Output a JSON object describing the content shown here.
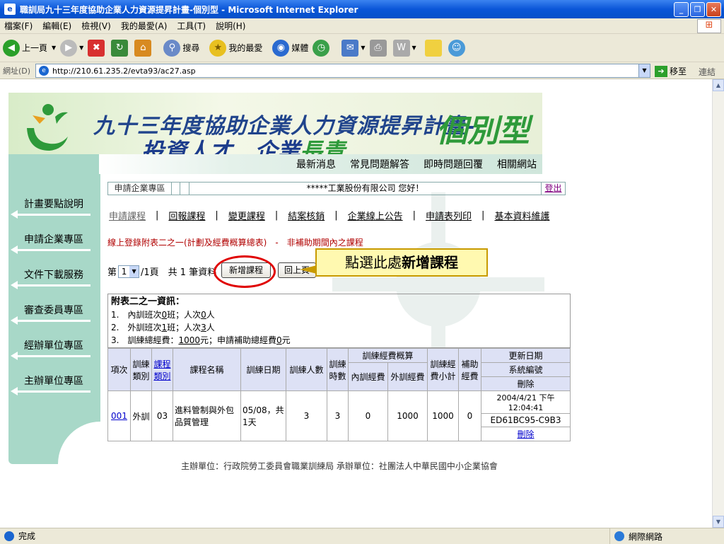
{
  "window": {
    "title": "職訓局九十三年度協助企業人力資源提昇計畫-個別型 - Microsoft Internet Explorer"
  },
  "menu": [
    "檔案(F)",
    "編輯(E)",
    "檢視(V)",
    "我的最愛(A)",
    "工具(T)",
    "說明(H)"
  ],
  "toolbar": {
    "back": "上一頁",
    "search": "搜尋",
    "favorites": "我的最愛",
    "media": "媒體"
  },
  "address": {
    "label": "網址(D)",
    "url": "http://210.61.235.2/evta93/ac27.asp",
    "go": "移至",
    "links": "連結"
  },
  "banner": {
    "line1": "九十三年度協助企業人力資源提昇計畫-",
    "line1b": "個別型",
    "line2a": "投資人才．企業",
    "line2b": "長青"
  },
  "topnav": [
    "最新消息",
    "常見問題解答",
    "即時問題回覆",
    "相關網站"
  ],
  "sidebar": [
    "計畫要點說明",
    "申請企業專區",
    "文件下載服務",
    "審查委員專區",
    "經辦單位專區",
    "主辦單位專區"
  ],
  "greeting": {
    "area": "申請企業專區",
    "company": "*****工業股份有限公司 您好！",
    "logout": "登出"
  },
  "subnav": [
    "申請課程",
    "回報課程",
    "變更課程",
    "結案核銷",
    "企業線上公告",
    "申請表列印",
    "基本資料維護"
  ],
  "notice": "線上登錄附表二之一(計劃及經費概算總表)　-　非補助期間內之課程",
  "pager": {
    "prefix": "第",
    "page": "1",
    "suffix": "/1頁　共 1 筆資料",
    "add_btn": "新增課程",
    "btn2": "回上頁"
  },
  "callout": {
    "text": "點選此處",
    "bold": "新增課程"
  },
  "info": {
    "title": "附表二之一資訊：",
    "l1a": "1.　內訓班次",
    "l1b": "0",
    "l1c": "班；人次",
    "l1d": "0",
    "l1e": "人",
    "l2a": "2.　外訓班次",
    "l2b": "1",
    "l2c": "班；人次",
    "l2d": "3",
    "l2e": "人",
    "l3a": "3.　訓練總經費：",
    "l3b": "1000",
    "l3c": "元；申請補助總經費",
    "l3d": "0",
    "l3e": "元"
  },
  "table": {
    "h_no": "項次",
    "h_type": "訓練類別",
    "h_cat": "課程類別",
    "h_name": "課程名稱",
    "h_date": "訓練日期",
    "h_people": "訓練人數",
    "h_hours": "訓練時數",
    "h_budget": "訓練經費概算",
    "h_inner": "內訓經費",
    "h_outer": "外訓經費",
    "h_subtotal": "訓練經費小計",
    "h_subsidy": "補助經費",
    "h_update": "更新日期",
    "h_sysno": "系統編號",
    "h_delete": "刪除",
    "row": {
      "no": "001",
      "type": "外訓",
      "cat": "03",
      "name": "進料管制與外包品質管理",
      "date": "05/08，共1天",
      "people": "3",
      "hours": "3",
      "inner": "0",
      "outer": "1000",
      "subtotal": "1000",
      "subsidy": "0",
      "updated": "2004/4/21 下午 12:04:41",
      "sysno": "ED61BC95-C9B3",
      "delete": "刪除"
    }
  },
  "footer": "主辦單位：行政院勞工委員會職業訓練局 承辦單位：社團法人中華民國中小企業協會",
  "status": {
    "text": "完成",
    "zone": "網際網路"
  }
}
